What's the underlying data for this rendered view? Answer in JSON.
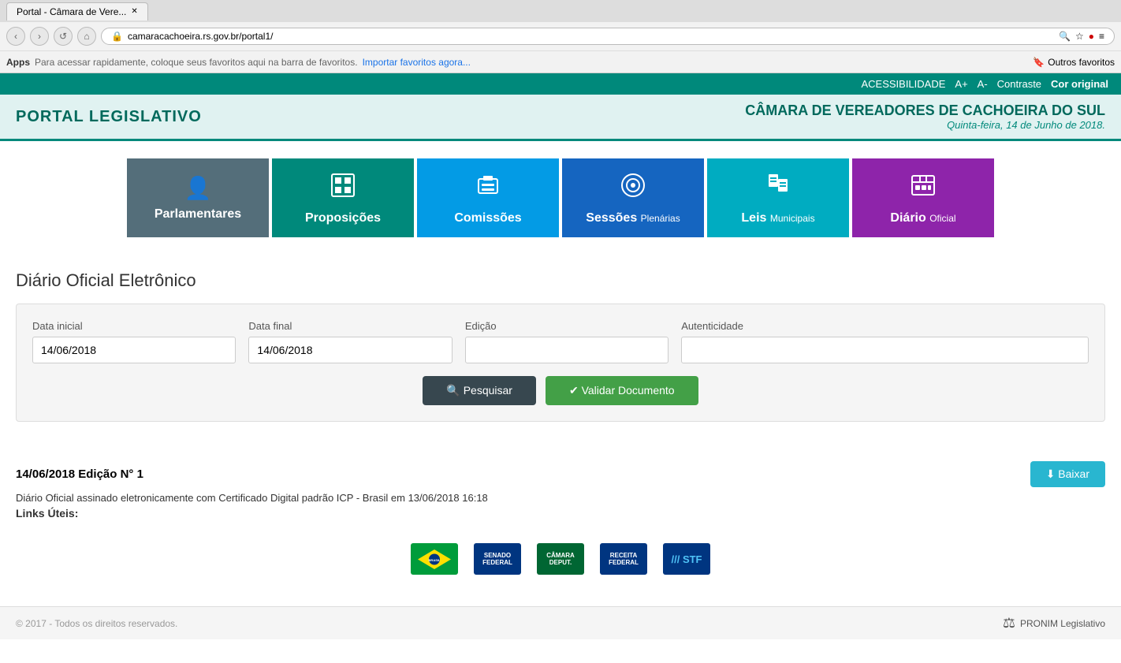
{
  "browser": {
    "tab_title": "Portal - Câmara de Vere...",
    "address": "camaracachoeira.rs.gov.br/portal1/",
    "bookmarks_text": "Para acessar rapidamente, coloque seus favoritos aqui na barra de favoritos.",
    "import_link": "Importar favoritos agora...",
    "outros_favoritos": "Outros favoritos",
    "apps_label": "Apps"
  },
  "accessibility": {
    "label": "ACESSIBILIDADE",
    "increase": "A+",
    "decrease": "A-",
    "contrast": "Contraste",
    "original_color": "Cor original"
  },
  "header": {
    "portal_title": "PORTAL LEGISLATIVO",
    "camara_name": "CÂMARA DE VEREADORES DE CACHOEIRA DO SUL",
    "date": "Quinta-feira, 14 de Junho de 2018."
  },
  "nav_tiles": [
    {
      "id": "parlamentares",
      "label": "Parlamentares",
      "icon": "👤",
      "class": "tile-parlamentares"
    },
    {
      "id": "proposicoes",
      "label": "Proposições",
      "icon": "⬛",
      "class": "tile-proposicoes"
    },
    {
      "id": "comissoes",
      "label": "Comissões",
      "icon": "📥",
      "class": "tile-comissoes"
    },
    {
      "id": "sessoes",
      "label": "Sessões",
      "label_small": "Plenárias",
      "icon": "👁",
      "class": "tile-sessoes"
    },
    {
      "id": "leis",
      "label": "Leis",
      "label_small": "Municipais",
      "icon": "📄",
      "class": "tile-leis"
    },
    {
      "id": "diario",
      "label": "Diário",
      "label_small": "Oficial",
      "icon": "📅",
      "class": "tile-diario"
    }
  ],
  "section": {
    "title": "Diário Oficial Eletrônico"
  },
  "form": {
    "data_inicial_label": "Data inicial",
    "data_inicial_value": "14/06/2018",
    "data_final_label": "Data final",
    "data_final_value": "14/06/2018",
    "edicao_label": "Edição",
    "edicao_value": "",
    "autenticidade_label": "Autenticidade",
    "autenticidade_value": "",
    "pesquisar_label": "🔍 Pesquisar",
    "validar_label": "✔ Validar Documento"
  },
  "result": {
    "date_edition": "14/06/2018  Edição N° 1",
    "description": "Diário Oficial assinado eletronicamente com Certificado Digital padrão ICP - Brasil em  13/06/2018 16:18",
    "links_title": "Links Úteis:",
    "baixar_label": "⬇ Baixar"
  },
  "footer": {
    "copyright": "© 2017 - Todos os direitos reservados.",
    "brand": "PRONIM Legislativo"
  },
  "links": [
    {
      "id": "brasil",
      "label": "Brasil"
    },
    {
      "id": "senado",
      "label": "Senado Federal"
    },
    {
      "id": "camara",
      "label": "Câmara dos Deputados"
    },
    {
      "id": "receita",
      "label": "Receita Federal"
    },
    {
      "id": "stf",
      "label": "STF"
    }
  ]
}
